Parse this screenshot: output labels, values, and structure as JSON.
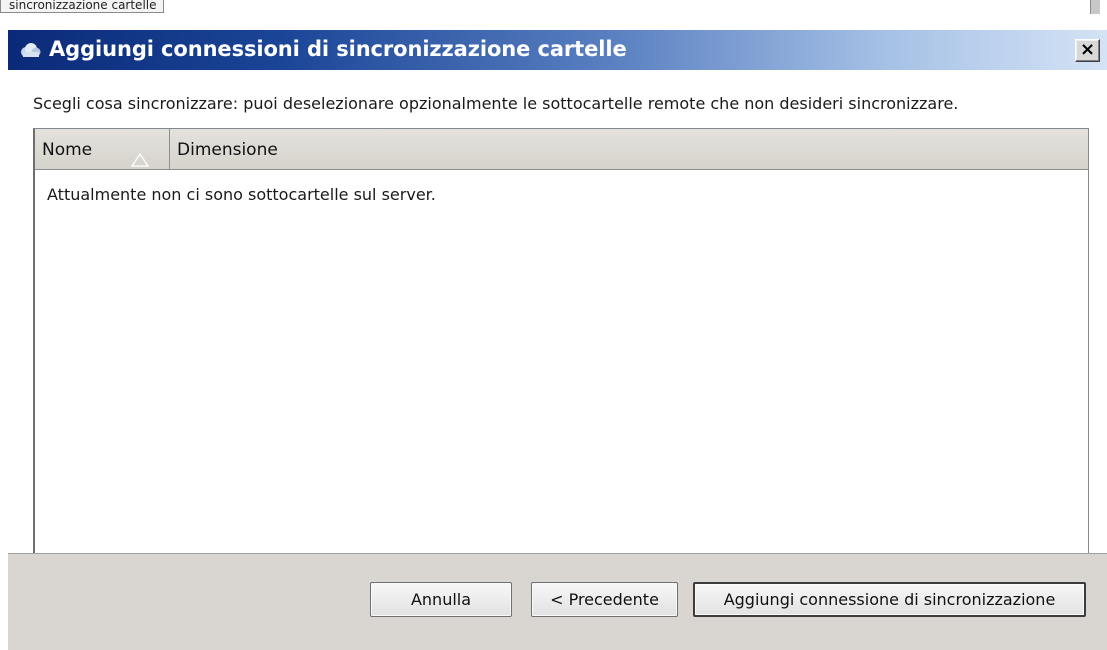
{
  "background_tab": {
    "label": "sincronizzazione cartelle"
  },
  "dialog": {
    "title": "Aggiungi connessioni di sincronizzazione cartelle",
    "close_label": "×",
    "instruction": "Scegli cosa sincronizzare: puoi deselezionare opzionalmente le sottocartelle remote che non desideri sincronizzare."
  },
  "table": {
    "columns": [
      {
        "label": "Nome",
        "sort": "ascending"
      },
      {
        "label": "Dimensione"
      }
    ],
    "empty_message": "Attualmente non ci sono sottocartelle sul server."
  },
  "buttons": {
    "cancel": "Annulla",
    "previous": "< Precedente",
    "add": "Aggiungi connessione di sincronizzazione"
  },
  "icons": {
    "app": "cloud-icon",
    "sort": "sort-up-icon",
    "close": "close-icon"
  },
  "colors": {
    "title_gradient_start": "#0a2a78",
    "title_gradient_end": "#d4e3f5",
    "panel_bg": "#d9d6d1"
  }
}
